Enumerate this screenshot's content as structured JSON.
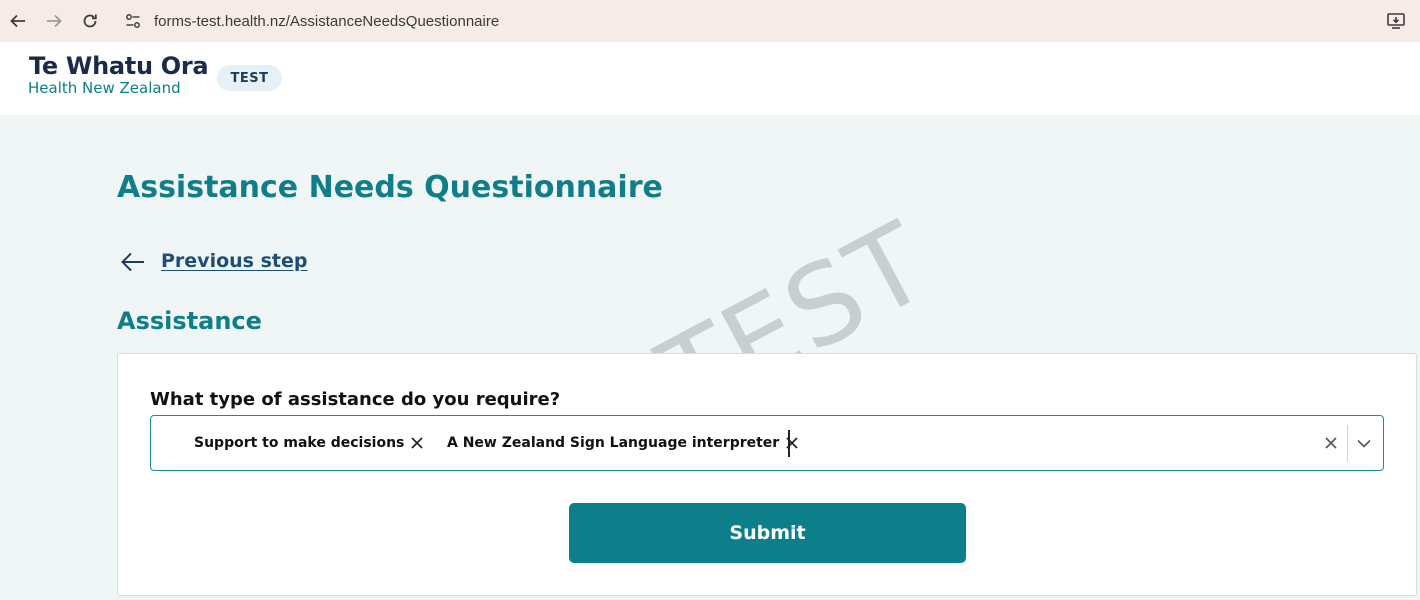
{
  "browser": {
    "url": "forms-test.health.nz/AssistanceNeedsQuestionnaire",
    "icons": [
      "back-icon",
      "forward-icon",
      "reload-icon",
      "site-info-icon",
      "install-app-icon"
    ]
  },
  "header": {
    "logo_main": "Te Whatu Ora",
    "logo_sub": "Health New Zealand",
    "env_badge": "TEST"
  },
  "watermark": {
    "text": "TEST"
  },
  "main": {
    "page_title": "Assistance Needs Questionnaire",
    "previous_step": "Previous step",
    "section_title": "Assistance",
    "question": "What type of assistance do you require?",
    "selected_options": [
      "Support to make decisions",
      "A New Zealand Sign Language interpreter"
    ],
    "submit_label": "Submit"
  },
  "colors": {
    "accent": "#0d7f8a",
    "heading": "#0f7e8a",
    "link": "#1d4e7a",
    "page_bg": "#f0f6f6",
    "browser_bar": "#f7ebe8"
  }
}
